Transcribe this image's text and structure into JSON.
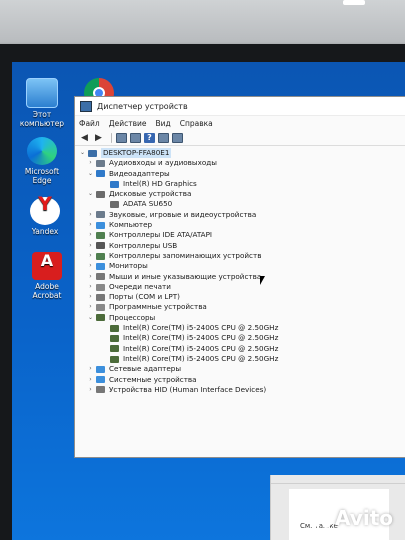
{
  "desktop": {
    "icons": [
      {
        "label": "Этот\nкомпьютер",
        "icon": "computer-icon"
      },
      {
        "label": "Microsoft\nEdge",
        "icon": "edge-icon"
      },
      {
        "label": "Yandex",
        "icon": "yandex-icon"
      },
      {
        "label": "Adobe\nAcrobat",
        "icon": "acrobat-icon"
      }
    ]
  },
  "window": {
    "title": "Диспетчер устройств",
    "menu": [
      "Файл",
      "Действие",
      "Вид",
      "Справка"
    ]
  },
  "tree": {
    "root": "DESKTOP-FFA80E1",
    "items": [
      {
        "label": "Аудиовходы и аудиовыходы",
        "level": 1,
        "expanded": false,
        "color": "#6b7b8c"
      },
      {
        "label": "Видеоадаптеры",
        "level": 1,
        "expanded": true,
        "color": "#2f79c9"
      },
      {
        "label": "Intel(R) HD Graphics",
        "level": 2,
        "color": "#2f79c9"
      },
      {
        "label": "Дисковые устройства",
        "level": 1,
        "expanded": true,
        "color": "#6b6b6b"
      },
      {
        "label": "ADATA SU650",
        "level": 2,
        "color": "#6b6b6b"
      },
      {
        "label": "Звуковые, игровые и видеоустройства",
        "level": 1,
        "expanded": false,
        "color": "#6b7b8c"
      },
      {
        "label": "Компьютер",
        "level": 1,
        "expanded": false,
        "color": "#3c8fdc"
      },
      {
        "label": "Контроллеры IDE ATA/ATAPI",
        "level": 1,
        "expanded": false,
        "color": "#4f7f4f"
      },
      {
        "label": "Контроллеры USB",
        "level": 1,
        "expanded": false,
        "color": "#555"
      },
      {
        "label": "Контроллеры запоминающих устройств",
        "level": 1,
        "expanded": false,
        "color": "#4f7f4f"
      },
      {
        "label": "Мониторы",
        "level": 1,
        "expanded": false,
        "color": "#3c8fdc"
      },
      {
        "label": "Мыши и иные указывающие устройства",
        "level": 1,
        "expanded": false,
        "color": "#777"
      },
      {
        "label": "Очереди печати",
        "level": 1,
        "expanded": false,
        "color": "#888"
      },
      {
        "label": "Порты (COM и LPT)",
        "level": 1,
        "expanded": false,
        "color": "#777"
      },
      {
        "label": "Программные устройства",
        "level": 1,
        "expanded": false,
        "color": "#888"
      },
      {
        "label": "Процессоры",
        "level": 1,
        "expanded": true,
        "color": "#4c6b3a"
      },
      {
        "label": "Intel(R) Core(TM) i5-2400S CPU @ 2.50GHz",
        "level": 2,
        "color": "#4c6b3a"
      },
      {
        "label": "Intel(R) Core(TM) i5-2400S CPU @ 2.50GHz",
        "level": 2,
        "color": "#4c6b3a"
      },
      {
        "label": "Intel(R) Core(TM) i5-2400S CPU @ 2.50GHz",
        "level": 2,
        "color": "#4c6b3a"
      },
      {
        "label": "Intel(R) Core(TM) i5-2400S CPU @ 2.50GHz",
        "level": 2,
        "color": "#4c6b3a"
      },
      {
        "label": "Сетевые адаптеры",
        "level": 1,
        "expanded": false,
        "color": "#3c8fdc"
      },
      {
        "label": "Системные устройства",
        "level": 1,
        "expanded": false,
        "color": "#3c8fdc"
      },
      {
        "label": "Устройства HID (Human Interface Devices)",
        "level": 1,
        "expanded": false,
        "color": "#777"
      }
    ]
  },
  "side_panel": {
    "see_also": "См. также"
  },
  "watermark": "Avito"
}
